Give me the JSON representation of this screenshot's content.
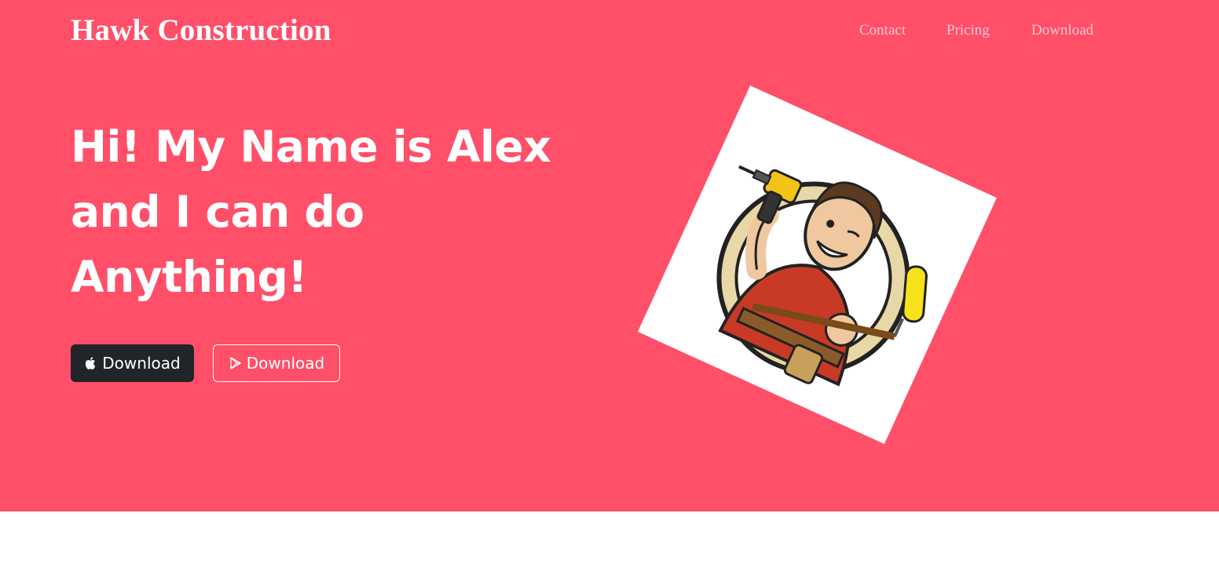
{
  "header": {
    "brand": "Hawk Construction",
    "nav": [
      "Contact",
      "Pricing",
      "Download"
    ]
  },
  "hero": {
    "headline": "Hi! My Name is Alex and I can do Anything!",
    "buttons": [
      {
        "label": "Download",
        "icon": "apple-icon"
      },
      {
        "label": "Download",
        "icon": "google-play-icon"
      }
    ],
    "illustration_icon": "handyman-mascot-illustration"
  },
  "colors": {
    "hero_background": "#ff4f69",
    "nav_link": "#ffc9d2",
    "dark_button": "#212529",
    "text": "#ffffff"
  }
}
